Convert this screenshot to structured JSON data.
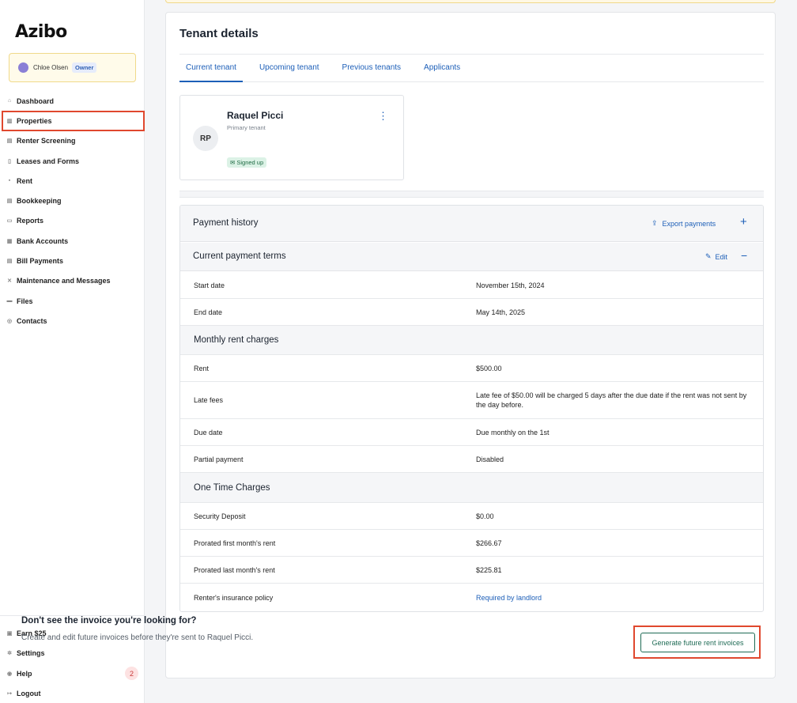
{
  "app": {
    "logo": "Azibo"
  },
  "user": {
    "name": "Chloe Olsen",
    "role": "Owner"
  },
  "sidebar": {
    "items": [
      {
        "label": "Dashboard",
        "icon": "home-icon"
      },
      {
        "label": "Properties",
        "icon": "building-icon"
      },
      {
        "label": "Renter Screening",
        "icon": "clipboard-icon"
      },
      {
        "label": "Leases and Forms",
        "icon": "document-icon"
      },
      {
        "label": "Rent",
        "icon": "chart-icon"
      },
      {
        "label": "Bookkeeping",
        "icon": "ledger-icon"
      },
      {
        "label": "Reports",
        "icon": "report-icon"
      },
      {
        "label": "Bank Accounts",
        "icon": "bank-icon"
      },
      {
        "label": "Bill Payments",
        "icon": "bill-icon"
      },
      {
        "label": "Maintenance and Messages",
        "icon": "tools-icon"
      },
      {
        "label": "Files",
        "icon": "folder-icon"
      },
      {
        "label": "Contacts",
        "icon": "contacts-icon"
      }
    ],
    "bottom": [
      {
        "label": "Earn $25",
        "icon": "gift-icon"
      },
      {
        "label": "Settings",
        "icon": "gear-icon"
      },
      {
        "label": "Help",
        "icon": "help-icon",
        "badge": "2"
      },
      {
        "label": "Logout",
        "icon": "logout-icon"
      }
    ]
  },
  "main": {
    "title": "Tenant details",
    "tabs": [
      "Current tenant",
      "Upcoming tenant",
      "Previous tenants",
      "Applicants"
    ],
    "active_tab": "Current tenant",
    "tenant": {
      "initials": "RP",
      "name": "Raquel Picci",
      "role": "Primary tenant",
      "status": "Signed up"
    },
    "payment_history": {
      "title": "Payment history",
      "export_label": "Export payments"
    },
    "payment_terms": {
      "title": "Current payment terms",
      "edit_label": "Edit",
      "start_date_label": "Start date",
      "start_date": "November 15th, 2024",
      "end_date_label": "End date",
      "end_date": "May 14th, 2025",
      "monthly_section": "Monthly rent charges",
      "rent_label": "Rent",
      "rent": "$500.00",
      "late_fees_label": "Late fees",
      "late_fees": "Late fee of $50.00 will be charged 5 days after the due date if the rent was not sent by the day before.",
      "due_date_label": "Due date",
      "due_date": "Due monthly on the 1st",
      "partial_label": "Partial payment",
      "partial": "Disabled",
      "one_time_section": "One Time Charges",
      "deposit_label": "Security Deposit",
      "deposit": "$0.00",
      "first_label": "Prorated first month's rent",
      "first": "$266.67",
      "last_label": "Prorated last month's rent",
      "last": "$225.81",
      "insurance_label": "Renter's insurance policy",
      "insurance": "Required by landlord"
    },
    "invoice": {
      "question": "Don't see the invoice you're looking for?",
      "subtitle": "Create and edit future invoices before they're sent to Raquel Picci.",
      "button": "Generate future rent invoices"
    }
  },
  "colors": {
    "accent": "#1d5fb8",
    "highlight": "#e0482e",
    "primary_button": "#1f6b55"
  }
}
